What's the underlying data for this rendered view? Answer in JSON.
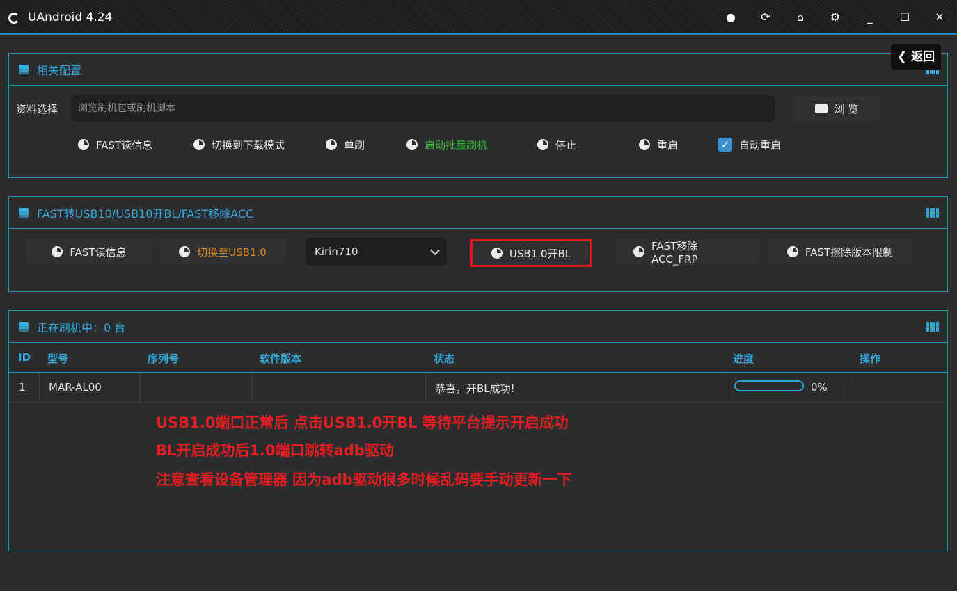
{
  "titlebar": {
    "title": "UAndroid 4.24",
    "icons": [
      "globe-icon",
      "refresh-icon",
      "home-icon",
      "gear-icon",
      "minimize-icon",
      "maximize-icon",
      "close-icon"
    ]
  },
  "back_button": "返回",
  "config_panel": {
    "title": "相关配置",
    "file_label": "资料选择",
    "file_placeholder": "浏览刷机包或刷机脚本",
    "browse_label": "浏 览",
    "actions": [
      "FAST读信息",
      "切换到下载模式",
      "单刷",
      "启动批量刷机",
      "停止",
      "重启"
    ],
    "auto_reboot_label": "自动重启",
    "auto_reboot_checked": true
  },
  "usb_panel": {
    "title": "FAST转USB10/USB10开BL/FAST移除ACC",
    "buttons": [
      "FAST读信息",
      "切换至USB1.0"
    ],
    "chip_select": "Kirin710",
    "buttons2": [
      "USB1.0开BL",
      "FAST移除ACC_FRP",
      "FAST擦除版本限制"
    ]
  },
  "device_panel": {
    "title": "正在刷机中：0 台",
    "columns": [
      "ID",
      "型号",
      "序列号",
      "软件版本",
      "状态",
      "进度",
      "操作"
    ],
    "rows": [
      {
        "id": "1",
        "model": "MAR-AL00",
        "serial": "",
        "version": "",
        "status": "恭喜，开BL成功!",
        "progress_text": "0%",
        "progress": 0
      }
    ]
  },
  "notes": [
    "USB1.0端口正常后 点击USB1.0开BL 等待平台提示开启成功",
    "BL开启成功后1.0端口跳转adb驱动",
    "注意查看设备管理器 因为adb驱动很多时候乱码要手动更新一下"
  ],
  "colors": {
    "accent": "#1f8fbf",
    "highlight_green": "#39c23a",
    "highlight_orange": "#e08a1c",
    "annotation_red": "#e81d22"
  }
}
